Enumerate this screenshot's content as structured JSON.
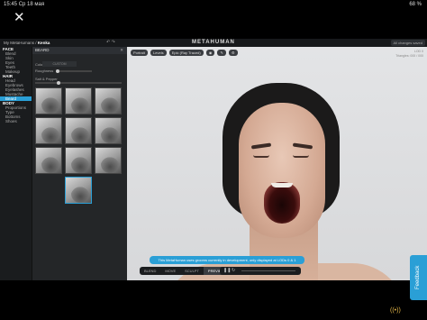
{
  "status": {
    "time": "15:45",
    "date": "Ср 18 мая",
    "dots": "•••",
    "battery": "68 %"
  },
  "topbar": {
    "breadcrumb_root": "My MetaHumans",
    "breadcrumb_sep": "/",
    "breadcrumb_current": "Kenka",
    "logo": "METAHUMAN",
    "saved": "All changes saved"
  },
  "nav": {
    "face_header": "FACE",
    "face_items": [
      "Blend",
      "Skin",
      "Eyes",
      "Teeth",
      "Makeup"
    ],
    "hair_header": "HAIR",
    "hair_items": [
      "Head",
      "Eyebrows",
      "Eyelashes",
      "Mustache",
      "Beard"
    ],
    "body_header": "BODY",
    "body_items": [
      "Proportions",
      "Type",
      "Bottoms",
      "Shoes"
    ]
  },
  "panel": {
    "title": "BEARD",
    "color_label": "Color",
    "color_value": "CUSTOM",
    "roughness_label": "Roughness",
    "salt_label": "Salt & Pepper"
  },
  "viewport": {
    "buttons": [
      "Portrait",
      "Levels",
      "Epic (Ray Traced)"
    ],
    "info_line1": "LOD 0",
    "info_line2": "Triangles: 000 / 000"
  },
  "notice": "This MetaHuman uses grooms currently in development, only displayed at LODs 0 & 1",
  "modes": [
    "BLEND",
    "MOVE",
    "SCULPT",
    "PREVIEW"
  ],
  "active_mode": "PREVIEW",
  "feedback": "Feedback",
  "colors": {
    "accent": "#2a9fd6",
    "panel": "#242628",
    "viewport": "#dcdde0"
  }
}
